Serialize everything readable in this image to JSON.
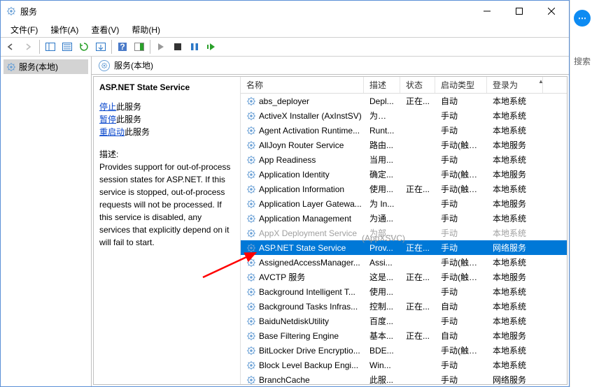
{
  "title": "服务",
  "menu": {
    "file": "文件(F)",
    "action": "操作(A)",
    "view": "查看(V)",
    "help": "帮助(H)"
  },
  "left_node": "服务(本地)",
  "right_header": "服务(本地)",
  "detail": {
    "name": "ASP.NET State Service",
    "stop_label": "停止",
    "pause_label": "暂停",
    "restart_label": "重启动",
    "action_suffix": "此服务",
    "desc_label": "描述:",
    "desc": "Provides support for out-of-process session states for ASP.NET. If this service is stopped, out-of-process requests will not be processed. If this service is disabled, any services that explicitly depend on it will fail to start."
  },
  "columns": {
    "name": "名称",
    "desc": "描述",
    "status": "状态",
    "start": "启动类型",
    "logon": "登录为"
  },
  "tooltip_appx": "(AppXSVC)",
  "sidebar_extra": {
    "search": "搜索"
  },
  "rows": [
    {
      "name": "abs_deployer",
      "desc": "Depl...",
      "status": "正在...",
      "start": "自动",
      "logon": "本地系统"
    },
    {
      "name": "ActiveX Installer (AxInstSV)",
      "desc": "为从 ...",
      "status": "",
      "start": "手动",
      "logon": "本地系统"
    },
    {
      "name": "Agent Activation Runtime...",
      "desc": "Runt...",
      "status": "",
      "start": "手动",
      "logon": "本地系统"
    },
    {
      "name": "AllJoyn Router Service",
      "desc": "路由...",
      "status": "",
      "start": "手动(触发...",
      "logon": "本地服务"
    },
    {
      "name": "App Readiness",
      "desc": "当用...",
      "status": "",
      "start": "手动",
      "logon": "本地系统"
    },
    {
      "name": "Application Identity",
      "desc": "确定...",
      "status": "",
      "start": "手动(触发...",
      "logon": "本地服务"
    },
    {
      "name": "Application Information",
      "desc": "使用...",
      "status": "正在...",
      "start": "手动(触发...",
      "logon": "本地系统"
    },
    {
      "name": "Application Layer Gatewa...",
      "desc": "为 In...",
      "status": "",
      "start": "手动",
      "logon": "本地服务"
    },
    {
      "name": "Application Management",
      "desc": "为通...",
      "status": "",
      "start": "手动",
      "logon": "本地系统"
    },
    {
      "name": "AppX Deployment Service",
      "desc": "为部...",
      "status": "",
      "start": "手动",
      "logon": "本地系统",
      "dim": true
    },
    {
      "name": "ASP.NET State Service",
      "desc": "Prov...",
      "status": "正在...",
      "start": "手动",
      "logon": "网络服务",
      "sel": true
    },
    {
      "name": "AssignedAccessManager...",
      "desc": "Assi...",
      "status": "",
      "start": "手动(触发...",
      "logon": "本地系统"
    },
    {
      "name": "AVCTP 服务",
      "desc": "这是...",
      "status": "正在...",
      "start": "手动(触发...",
      "logon": "本地服务"
    },
    {
      "name": "Background Intelligent T...",
      "desc": "使用...",
      "status": "",
      "start": "手动",
      "logon": "本地系统"
    },
    {
      "name": "Background Tasks Infras...",
      "desc": "控制...",
      "status": "正在...",
      "start": "自动",
      "logon": "本地系统"
    },
    {
      "name": "BaiduNetdiskUtility",
      "desc": "百度...",
      "status": "",
      "start": "手动",
      "logon": "本地系统"
    },
    {
      "name": "Base Filtering Engine",
      "desc": "基本...",
      "status": "正在...",
      "start": "自动",
      "logon": "本地服务"
    },
    {
      "name": "BitLocker Drive Encryptio...",
      "desc": "BDE...",
      "status": "",
      "start": "手动(触发...",
      "logon": "本地系统"
    },
    {
      "name": "Block Level Backup Engi...",
      "desc": "Win...",
      "status": "",
      "start": "手动",
      "logon": "本地系统"
    },
    {
      "name": "BranchCache",
      "desc": "此服...",
      "status": "",
      "start": "手动",
      "logon": "网络服务"
    }
  ]
}
